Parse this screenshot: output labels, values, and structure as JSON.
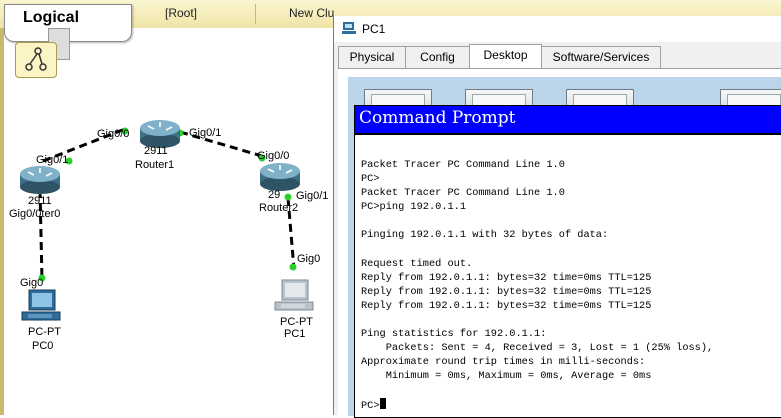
{
  "workspace": {
    "view_label": "Logical",
    "root_label": "[Root]",
    "new_cluster_label": "New Clu"
  },
  "topology": {
    "routers": [
      {
        "id": "router1",
        "model": "2911",
        "name": "Router1"
      },
      {
        "id": "router0",
        "model": "2911",
        "name": ""
      },
      {
        "id": "router2",
        "model": "29",
        "name": "Router2"
      }
    ],
    "pcs": [
      {
        "id": "pc0",
        "model": "PC-PT",
        "name": "PC0"
      },
      {
        "id": "pc1",
        "model": "PC-PT",
        "name": "PC1"
      }
    ],
    "port_labels": {
      "r1_left": "Gig0/0",
      "r1_right": "Gig0/1",
      "r0_top": "Gig0/1",
      "r0_bottom": "Gig0/0ter0",
      "r2_top": "Gig0/0",
      "r2_right": "Gig0/1",
      "pc0_port": "Gig0",
      "pc1_port": "Gig0"
    },
    "colors": {
      "link": "#000000",
      "port_dot": "#2bd12b"
    }
  },
  "window": {
    "title": "PC1",
    "tabs": [
      {
        "label": "Physical",
        "active": false
      },
      {
        "label": "Config",
        "active": false
      },
      {
        "label": "Desktop",
        "active": true
      },
      {
        "label": "Software/Services",
        "active": false
      }
    ]
  },
  "command_prompt": {
    "title": "Command Prompt",
    "header_color": "#0000ff",
    "lines": [
      "Packet Tracer PC Command Line 1.0",
      "PC>",
      "Packet Tracer PC Command Line 1.0",
      "PC>ping 192.0.1.1",
      "",
      "Pinging 192.0.1.1 with 32 bytes of data:",
      "",
      "Request timed out.",
      "Reply from 192.0.1.1: bytes=32 time=0ms TTL=125",
      "Reply from 192.0.1.1: bytes=32 time=0ms TTL=125",
      "Reply from 192.0.1.1: bytes=32 time=0ms TTL=125",
      "",
      "Ping statistics for 192.0.1.1:",
      "    Packets: Sent = 4, Received = 3, Lost = 1 (25% loss),",
      "Approximate round trip times in milli-seconds:",
      "    Minimum = 0ms, Maximum = 0ms, Average = 0ms",
      ""
    ],
    "prompt": "PC>"
  }
}
